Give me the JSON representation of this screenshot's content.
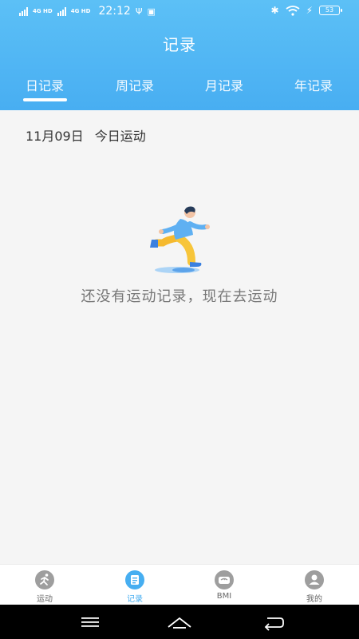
{
  "statusbar": {
    "network1": "4G HD",
    "network2": "4G HD",
    "time": "22:12",
    "battery": "53"
  },
  "header": {
    "title": "记录"
  },
  "tabs": [
    {
      "label": "日记录",
      "active": true
    },
    {
      "label": "周记录",
      "active": false
    },
    {
      "label": "月记录",
      "active": false
    },
    {
      "label": "年记录",
      "active": false
    }
  ],
  "today": {
    "date": "11月09日",
    "label": "今日运动"
  },
  "empty": {
    "message": "还没有运动记录，现在去运动"
  },
  "bottom_nav": [
    {
      "label": "运动",
      "icon": "running-icon",
      "active": false
    },
    {
      "label": "记录",
      "icon": "record-icon",
      "active": true
    },
    {
      "label": "BMI",
      "icon": "bmi-scale-icon",
      "active": false
    },
    {
      "label": "我的",
      "icon": "user-icon",
      "active": false
    }
  ],
  "colors": {
    "accent": "#46aef1",
    "inactive_icon": "#9e9e9e",
    "background": "#f5f5f5"
  }
}
